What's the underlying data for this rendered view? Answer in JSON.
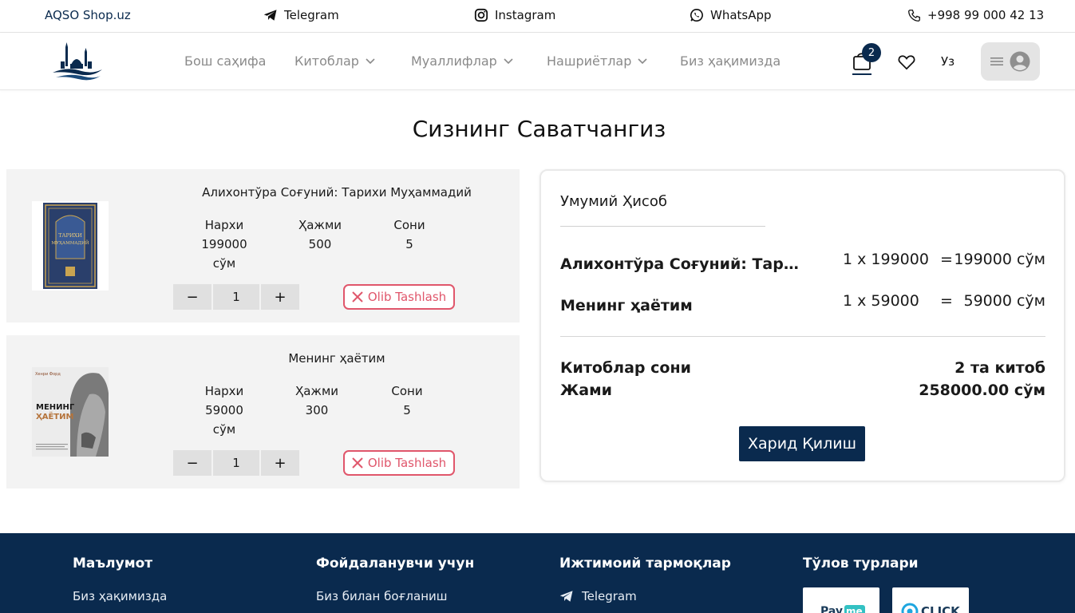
{
  "topbar": {
    "brand": "AQSO Shop.uz",
    "telegram": "Telegram",
    "instagram": "Instagram",
    "whatsapp": "WhatsApp",
    "phone": "+998 99 000 42 13"
  },
  "nav": {
    "home": "Бош саҳифа",
    "books": "Китоблар",
    "authors": "Муаллифлар",
    "publishers": "Нашриётлар",
    "about": "Биз ҳақимизда",
    "cart_count": "2",
    "language": "Уз"
  },
  "page": {
    "title": "Сизнинг Саватчангиз"
  },
  "cart_items": [
    {
      "title": "Алихонтўра Соғуний: Тарихи Муҳаммадий",
      "price_label": "Нархи",
      "price": "199000",
      "currency": "сўм",
      "volume_label": "Ҳажми",
      "volume": "500",
      "count_label": "Сони",
      "count": "5",
      "quantity": "1",
      "remove_label": "Olib Tashlash",
      "cover_text": "ТАРИХИ МУҲАММАДИЙ"
    },
    {
      "title": "Менинг ҳаётим",
      "price_label": "Нархи",
      "price": "59000",
      "currency": "сўм",
      "volume_label": "Ҳажми",
      "volume": "300",
      "count_label": "Сони",
      "count": "5",
      "quantity": "1",
      "remove_label": "Olib Tashlash",
      "cover_author": "Хенри Форд",
      "cover_text_1": "МЕНИНГ",
      "cover_text_2": "ҲАЁТИМ"
    }
  ],
  "summary": {
    "title": "Умумий Ҳисоб",
    "rows": [
      {
        "name": "Алихонтўра Соғуний: Тарих...",
        "calc": "1 x 199000",
        "eq": "=",
        "total": "199000 сўм"
      },
      {
        "name": "Менинг ҳаётим",
        "calc": "1 x 59000",
        "eq": "=",
        "total": "59000 сўм"
      }
    ],
    "books_count_label": "Китоблар сони",
    "books_count_value": "2 та китоб",
    "sum_label": "Жами",
    "sum_value": "258000.00 сўм",
    "buy_label": "Харид Қилиш"
  },
  "footer": {
    "info_title": "Маълумот",
    "info_link": "Биз ҳақимизда",
    "user_title": "Фойдаланувчи учун",
    "user_link": "Биз билан боғланиш",
    "social_title": "Ижтимоий тармоқлар",
    "social_link": "Telegram",
    "pay_title": "Тўлов турлари",
    "payme": "Payme",
    "click": "CLICK"
  },
  "colors": {
    "navy": "#0a2a4e",
    "remove_red": "#e0566b",
    "item_bg": "#f3f3f3"
  }
}
